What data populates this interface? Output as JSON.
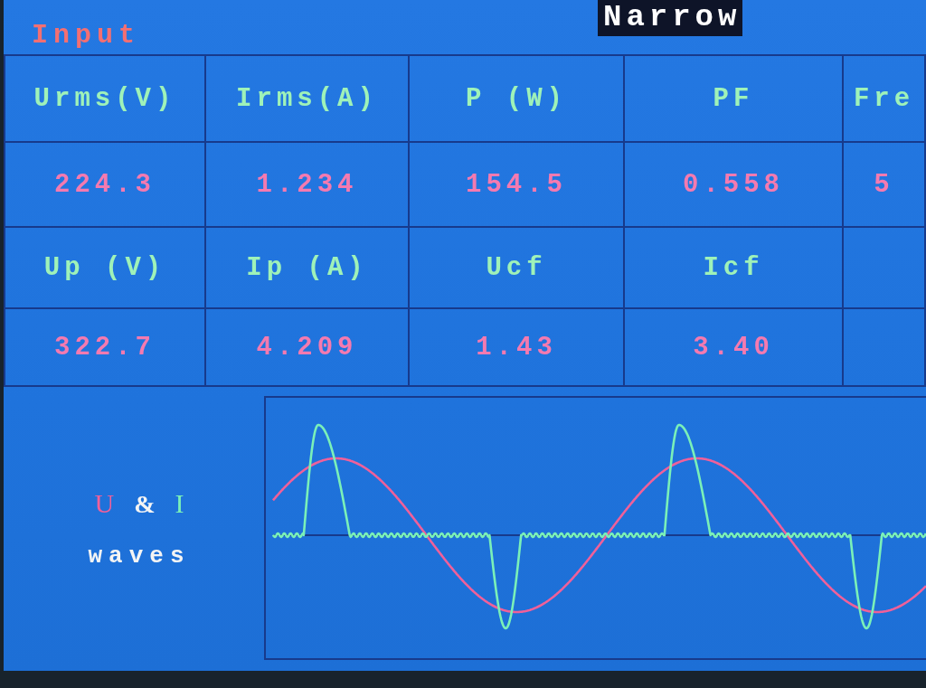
{
  "header": {
    "title": "Input",
    "mode": "Narrow"
  },
  "table": {
    "rows": [
      {
        "kind": "label",
        "cells": [
          "Urms(V)",
          "Irms(A)",
          "P (W)",
          "PF",
          "Fre"
        ]
      },
      {
        "kind": "value",
        "cells": [
          "224.3",
          "1.234",
          "154.5",
          "0.558",
          "5"
        ]
      },
      {
        "kind": "label",
        "cells": [
          "Up (V)",
          "Ip (A)",
          "Ucf",
          "Icf"
        ]
      },
      {
        "kind": "value",
        "cells": [
          "322.7",
          "4.209",
          "1.43",
          "3.40"
        ]
      }
    ]
  },
  "waves": {
    "legend": [
      {
        "name": "U",
        "kind": "voltage",
        "color": "#f0609a"
      },
      {
        "name": "I",
        "kind": "current",
        "color": "#7af0b8"
      }
    ],
    "joiner": "&",
    "caption": "waves"
  }
}
